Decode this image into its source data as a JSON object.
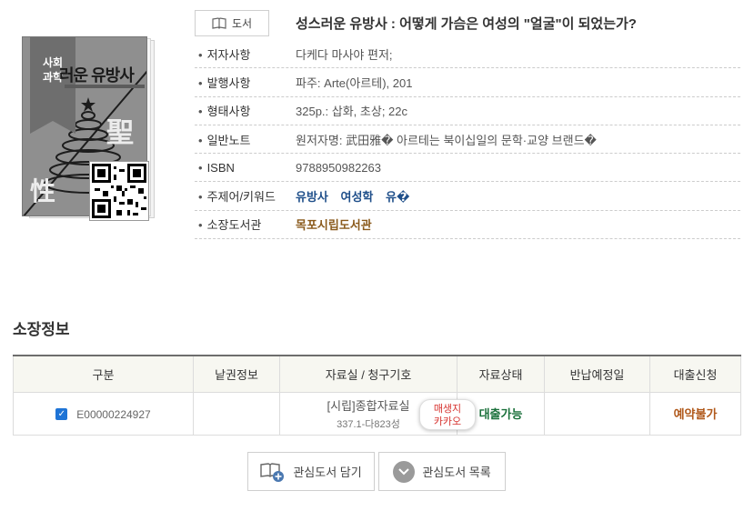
{
  "book": {
    "type_button": "도서",
    "title": "성스러운 유방사 : 어떻게 가슴은 여성의 \"얼굴\"이 되었는가?",
    "cover": {
      "ribbon": "사회\n과학",
      "title_text": "러운 유방사",
      "big_glyph_1": "聖",
      "big_glyph_2": "性"
    }
  },
  "meta": [
    {
      "label": "저자사항",
      "value": "다케다 마사야 편저;"
    },
    {
      "label": "발행사항",
      "value": "파주: Arte(아르테), 201"
    },
    {
      "label": "형태사항",
      "value": "325p.: 삽화, 초상; 22c"
    },
    {
      "label": "일반노트",
      "value": "원저자명: 武田雅� 아르테는 북이십일의 문학·교양 브랜드�"
    },
    {
      "label": "ISBN",
      "value": "9788950982263"
    },
    {
      "label": "주제어/키워드",
      "keywords": [
        "유방사",
        "여성학",
        "유�"
      ]
    },
    {
      "label": "소장도서관",
      "value": "목포시립도서관"
    }
  ],
  "holdings": {
    "section_title": "소장정보",
    "headers": [
      "구분",
      "낱권정보",
      "자료실 / 청구기호",
      "자료상태",
      "반납예정일",
      "대출신청"
    ],
    "rows": [
      {
        "reg_no": "E00000224927",
        "volume": "",
        "location": "[시립]종합자료실",
        "call_no": "337.1-다823성",
        "kakao_badge": "매생지\n카카오",
        "status": "대출가능",
        "due_date": "",
        "loan_request": "예약불가"
      }
    ]
  },
  "buttons": {
    "add_favorite": "관심도서 담기",
    "favorite_list": "관심도서 목록"
  },
  "colors": {
    "keyword": "#1f4f8a",
    "library": "#8a5a1c",
    "status_available": "#19703a",
    "reserve_unavailable": "#b0581a",
    "checkbox": "#1e74d6"
  }
}
